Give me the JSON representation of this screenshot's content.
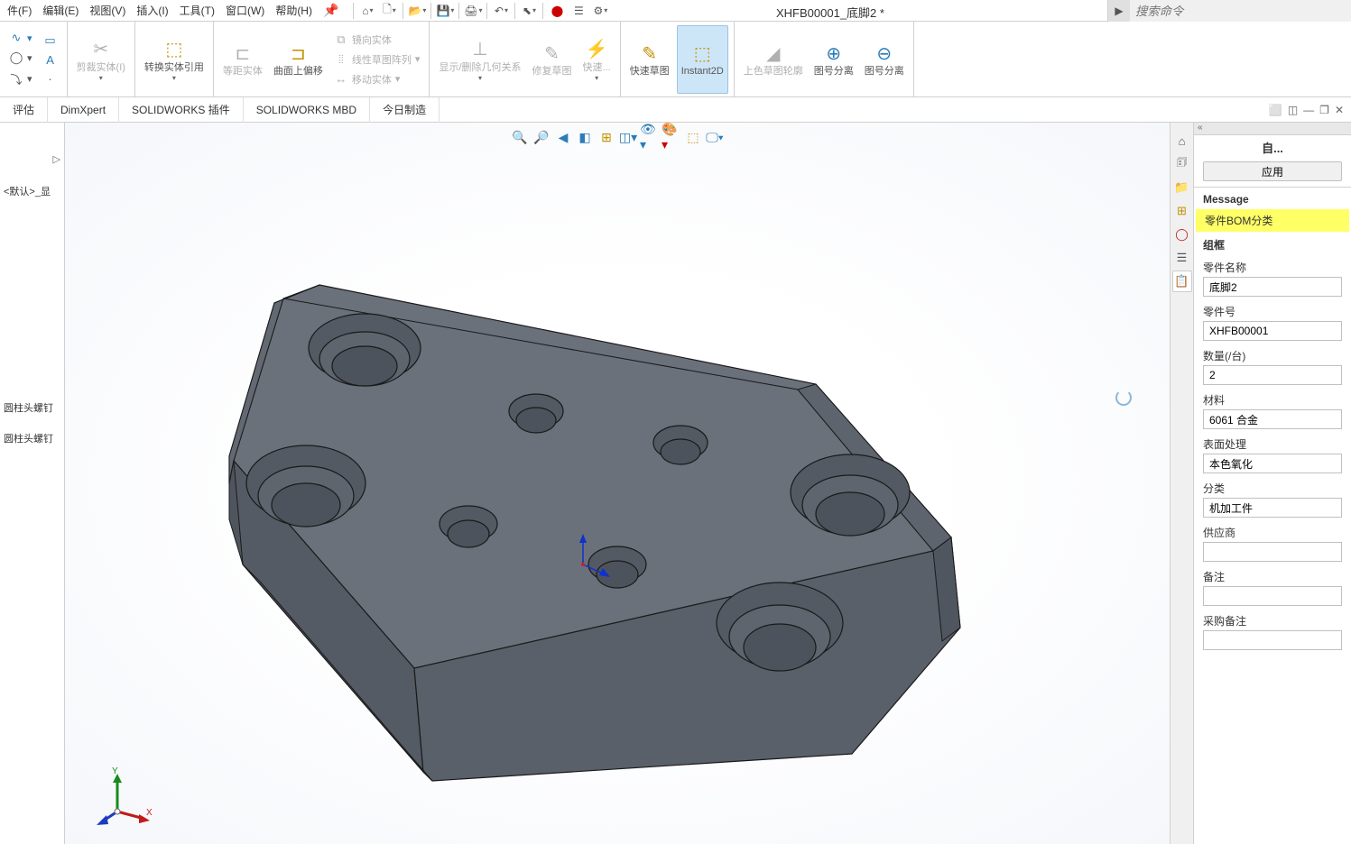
{
  "menubar": {
    "items": [
      "件(F)",
      "编辑(E)",
      "视图(V)",
      "插入(I)",
      "工具(T)",
      "窗口(W)",
      "帮助(H)"
    ]
  },
  "docTitle": "XHFB00001_底脚2 *",
  "search": {
    "placeholder": "搜索命令"
  },
  "ribbon": {
    "trimEntity": "剪裁实体(I)",
    "convertRef": "转换实体引用",
    "equidist": "等距实体",
    "curveOffset": "曲面上偏移",
    "mirror": "镜向实体",
    "linearPattern": "线性草图阵列",
    "moveEntity": "移动实体",
    "showHideRel": "显示/删除几何关系",
    "repairSketch": "修复草图",
    "quick": "快速...",
    "quickSketch": "快速草图",
    "instant2d": "Instant2D",
    "shadedSketch": "上色草图轮廓",
    "detachSeg1": "图号分离",
    "detachSeg2": "图号分离"
  },
  "tabs": [
    "评估",
    "DimXpert",
    "SOLIDWORKS 插件",
    "SOLIDWORKS MBD",
    "今日制造"
  ],
  "leftTree": {
    "default": "<默认>_显",
    "item1": "圆柱头螺钉",
    "item2": "圆柱头螺钉"
  },
  "propPanel": {
    "title": "自...",
    "applyBtn": "应用",
    "messageHead": "Message",
    "messageBody": "零件BOM分类",
    "groupHead": "组框",
    "fields": {
      "nameLabel": "零件名称",
      "nameValue": "底脚2",
      "noLabel": "零件号",
      "noValue": "XHFB00001",
      "qtyLabel": "数量(/台)",
      "qtyValue": "2",
      "matLabel": "材料",
      "matValue": "6061 合金",
      "surfLabel": "表面处理",
      "surfValue": "本色氧化",
      "classLabel": "分类",
      "classValue": "机加工件",
      "supplierLabel": "供应商",
      "supplierValue": "",
      "remarkLabel": "备注",
      "remarkValue": "",
      "purchRemarkLabel": "采购备注",
      "purchRemarkValue": ""
    }
  }
}
